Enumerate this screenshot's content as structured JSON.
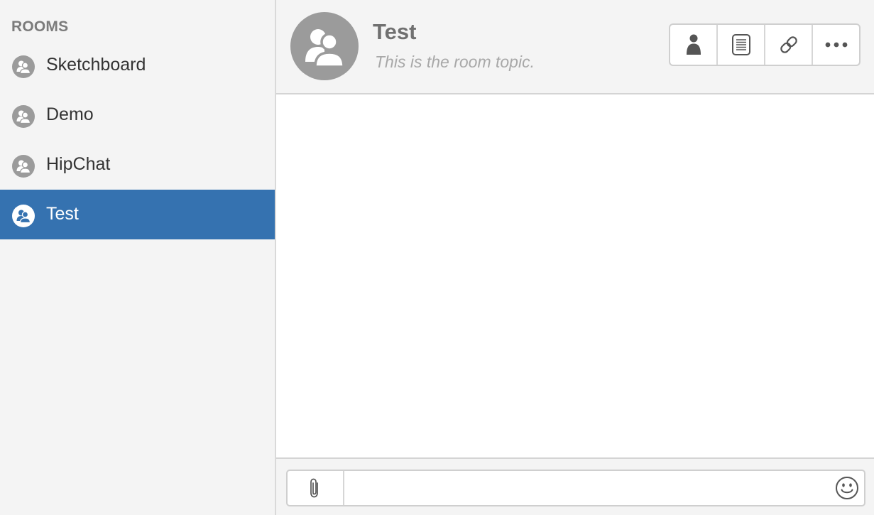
{
  "sidebar": {
    "heading": "ROOMS",
    "rooms": [
      {
        "label": "Sketchboard",
        "icon": "room-icon",
        "active": false
      },
      {
        "label": "Demo",
        "icon": "room-icon",
        "active": false
      },
      {
        "label": "HipChat",
        "icon": "room-icon",
        "active": false
      },
      {
        "label": "Test",
        "icon": "room-icon",
        "active": true
      }
    ]
  },
  "header": {
    "title": "Test",
    "topic": "This is the room topic.",
    "avatar_icon": "room-avatar-icon",
    "toolbar": [
      {
        "icon": "person-icon"
      },
      {
        "icon": "document-icon"
      },
      {
        "icon": "link-icon"
      },
      {
        "icon": "more-icon"
      }
    ]
  },
  "composer": {
    "attach_icon": "paperclip-icon",
    "message_value": "",
    "emoji_icon": "smiley-icon"
  },
  "colors": {
    "accent": "#3572b0",
    "sidebar_bg": "#f4f4f4",
    "icon_gray": "#9b9b9b"
  }
}
